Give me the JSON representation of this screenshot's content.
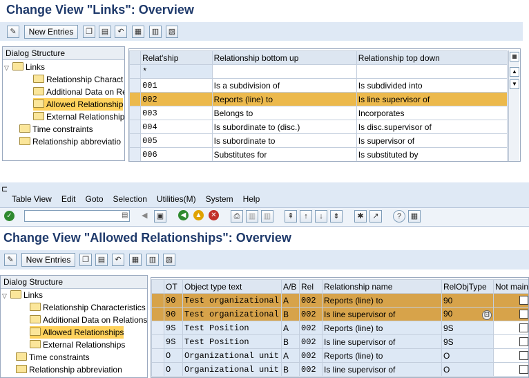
{
  "top": {
    "title": "Change View \"Links\": Overview",
    "new_entries": "New Entries",
    "dialog_structure": "Dialog Structure",
    "tree": [
      "Links",
      "Relationship Charact",
      "Additional Data on Re",
      "Allowed Relationship",
      "External Relationship",
      "Time constraints",
      "Relationship abbreviatio"
    ],
    "columns": [
      "Relat'ship",
      "Relationship bottom up",
      "Relationship top down"
    ],
    "rows": [
      [
        "*",
        "",
        ""
      ],
      [
        "001",
        "Is a subdivision of",
        "Is subdivided into"
      ],
      [
        "002",
        "Reports (line) to",
        "Is line supervisor of"
      ],
      [
        "003",
        "Belongs to",
        "Incorporates"
      ],
      [
        "004",
        "Is subordinate to (disc.)",
        "Is disc.supervisor of"
      ],
      [
        "005",
        "Is subordinate to",
        "Is supervisor of"
      ],
      [
        "006",
        "Substitutes for",
        "Is substituted by"
      ]
    ]
  },
  "menu": [
    "Table View",
    "Edit",
    "Goto",
    "Selection",
    "Utilities(M)",
    "System",
    "Help"
  ],
  "bottom": {
    "title": "Change View \"Allowed Relationships\": Overview",
    "new_entries": "New Entries",
    "dialog_structure": "Dialog Structure",
    "tree": [
      "Links",
      "Relationship Characteristics",
      "Additional Data on Relations",
      "Allowed Relationships",
      "External Relationships",
      "Time constraints",
      "Relationship abbreviation"
    ],
    "columns": [
      "OT",
      "Object type text",
      "A/B",
      "Rel",
      "Relationship name",
      "RelObjType",
      "Not maint"
    ],
    "rows": [
      [
        "90",
        "Test organizational u",
        "A",
        "002",
        "Reports (line) to",
        "90"
      ],
      [
        "90",
        "Test organizational u",
        "B",
        "002",
        "Is line supervisor of",
        "90"
      ],
      [
        "9S",
        "Test Position",
        "A",
        "002",
        "Reports (line) to",
        "9S"
      ],
      [
        "9S",
        "Test Position",
        "B",
        "002",
        "Is line supervisor of",
        "9S"
      ],
      [
        "O",
        "Organizational unit",
        "A",
        "002",
        "Reports (line) to",
        "O"
      ],
      [
        "O",
        "Organizational unit",
        "B",
        "002",
        "Is line supervisor of",
        "O"
      ]
    ]
  },
  "colors": {
    "title": "#1f3a6b",
    "highlight": "#ecb94c",
    "selected_tree": "#ffd25c"
  }
}
